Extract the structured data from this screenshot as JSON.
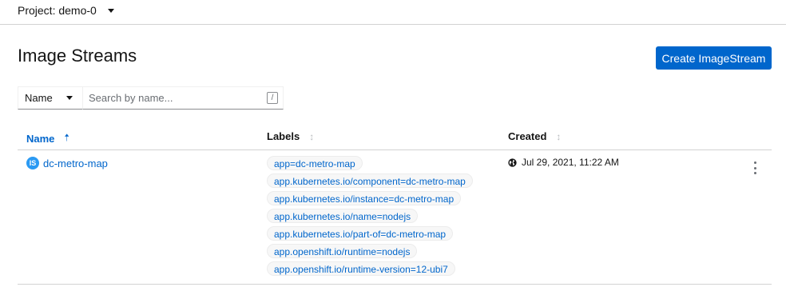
{
  "project_bar": {
    "label": "Project: demo-0"
  },
  "page": {
    "title": "Image Streams",
    "create_button": "Create ImageStream"
  },
  "filter": {
    "type_selected": "Name",
    "search_placeholder": "Search by name...",
    "shortcut_key": "/"
  },
  "table": {
    "columns": {
      "name": "Name",
      "labels": "Labels",
      "created": "Created"
    },
    "sort": {
      "column": "Name",
      "direction": "ascending"
    },
    "rows": [
      {
        "badge": "IS",
        "name": "dc-metro-map",
        "labels": [
          "app=dc-metro-map",
          "app.kubernetes.io/component=dc-metro-map",
          "app.kubernetes.io/instance=dc-metro-map",
          "app.kubernetes.io/name=nodejs",
          "app.kubernetes.io/part-of=dc-metro-map",
          "app.openshift.io/runtime=nodejs",
          "app.openshift.io/runtime-version=12-ubi7"
        ],
        "created": "Jul 29, 2021, 11:22 AM"
      }
    ]
  },
  "colors": {
    "accent": "#0066cc",
    "badge": "#2b9af3",
    "border": "#d2d2d2"
  },
  "icons": {
    "project_caret": "caret-down-icon",
    "sort_active": "arrow-up-icon",
    "sort_inactive": "sort-icon",
    "created": "globe-icon",
    "row_actions": "kebab-icon"
  }
}
